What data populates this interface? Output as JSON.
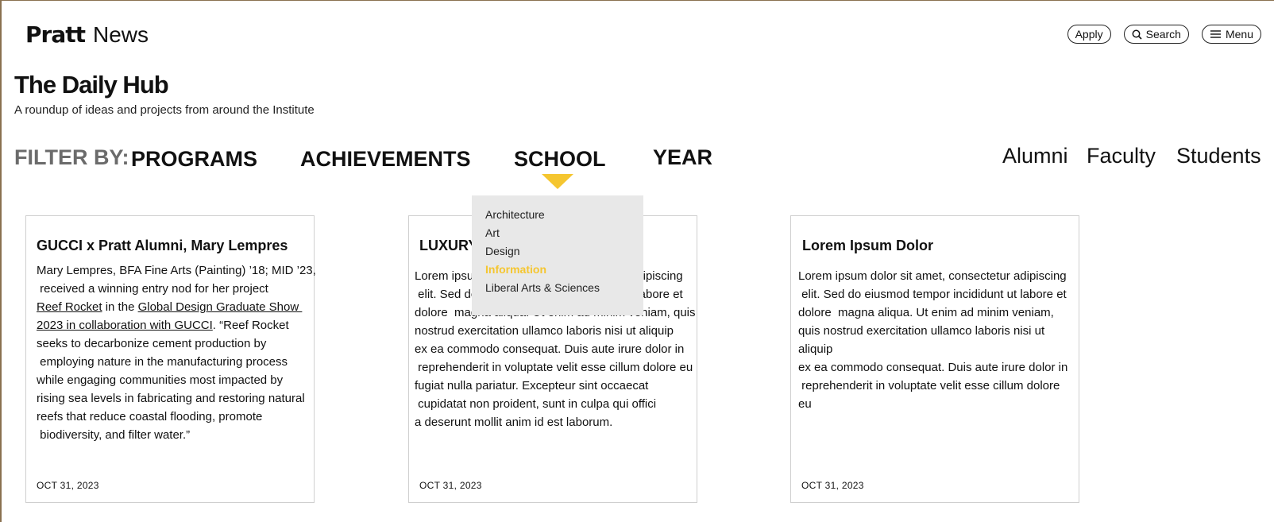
{
  "header": {
    "brand": "Pratt",
    "section": "News",
    "buttons": {
      "apply": "Apply",
      "search": "Search",
      "menu": "Menu"
    }
  },
  "hub": {
    "title": "The Daily Hub",
    "subtitle": "A roundup of ideas and projects from around the Institute"
  },
  "filter": {
    "label": "FILTER BY:",
    "options": [
      "PROGRAMS",
      "ACHIEVEMENTS",
      "SCHOOL",
      "YEAR"
    ],
    "active": "SCHOOL",
    "audience": [
      "Alumni",
      "Faculty",
      "Students"
    ]
  },
  "dropdown": {
    "items": [
      "Architecture",
      "Art",
      "Design",
      "Information",
      "Liberal Arts & Sciences"
    ],
    "highlighted": "Information"
  },
  "cards": [
    {
      "title": "GUCCI x Pratt Alumni, Mary Lempres",
      "body_intro": "Mary Lempres, BFA Fine Arts (Painting) ’18; MID ’23,\n received a winning entry nod for her project\n",
      "link1": "Reef Rocket",
      "body_mid": " in the ",
      "link2": "Global Design Graduate Show \n2023 in collaboration with GUCCI",
      "body_rest": ". “Reef Rocket\nseeks to decarbonize cement production by\n employing nature in the manufacturing process\nwhile engaging communities most impacted by\nrising sea levels in fabricating and restoring natural\nreefs that reduce coastal flooding, promote\n biodiversity, and filter water.”",
      "date": "OCT 31, 2023"
    },
    {
      "title": "LUXURY",
      "body": "Lorem ipsum dolor sit amet, consectetur adipiscing\n elit. Sed do eiusmod tempor incididunt ut labore et\ndolore  magna aliqua. Ut enim ad minim veniam, quis\nnostrud exercitation ullamco laboris nisi ut aliquip\nex ea commodo consequat. Duis aute irure dolor in\n reprehenderit in voluptate velit esse cillum dolore eu\nfugiat nulla pariatur. Excepteur sint occaecat\n cupidatat non proident, sunt in culpa qui offici\na deserunt mollit anim id est laborum.",
      "date": "OCT 31, 2023"
    },
    {
      "title": "Lorem Ipsum Dolor",
      "body": "Lorem ipsum dolor sit amet, consectetur adipiscing\n elit. Sed do eiusmod tempor incididunt ut labore et\ndolore  magna aliqua. Ut enim ad minim veniam,\nquis nostrud exercitation ullamco laboris nisi ut\naliquip\nex ea commodo consequat. Duis aute irure dolor in\n reprehenderit in voluptate velit esse cillum dolore\neu",
      "date": "OCT 31, 2023"
    }
  ],
  "colors": {
    "accent": "#f5c630",
    "filter_label": "#6b6b6b",
    "dropdown_bg": "#e8e8e8",
    "card_border": "#cfcfcf"
  },
  "icons": {
    "search": "search-icon",
    "menu": "hamburger-icon",
    "caret": "caret-down-icon"
  }
}
